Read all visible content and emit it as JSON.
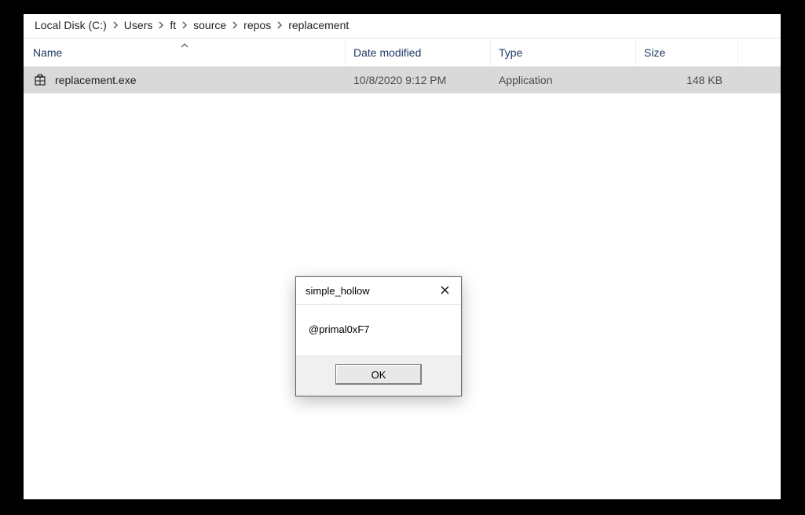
{
  "breadcrumbs": [
    "Local Disk (C:)",
    "Users",
    "ft",
    "source",
    "repos",
    "replacement"
  ],
  "columns": {
    "name": "Name",
    "date": "Date modified",
    "type": "Type",
    "size": "Size"
  },
  "files": [
    {
      "name": "replacement.exe",
      "date": "10/8/2020 9:12 PM",
      "type": "Application",
      "size": "148 KB"
    }
  ],
  "dialog": {
    "title": "simple_hollow",
    "message": "@primal0xF7",
    "ok_label": "OK"
  }
}
